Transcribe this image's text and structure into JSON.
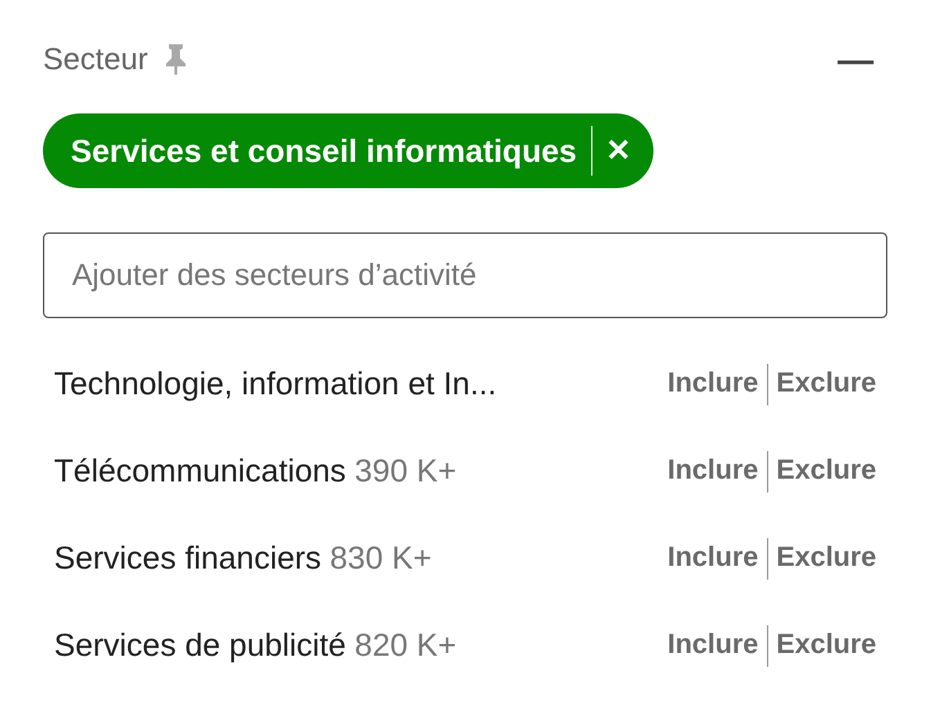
{
  "section": {
    "title": "Secteur",
    "collapse": "—"
  },
  "chip": {
    "label": "Services et conseil informatiques",
    "remove": "✕"
  },
  "search": {
    "placeholder": "Ajouter des secteurs d’activité"
  },
  "industries": [
    {
      "name": "Technologie, information et In...",
      "include": "Inclure",
      "exclude": "Exclure"
    },
    {
      "name": "Télécommunications",
      "count": "390 K+",
      "include": "Inclure",
      "exclude": "Exclure"
    },
    {
      "name": "Services financiers",
      "count": "830 K+",
      "include": "Inclure",
      "exclude": "Exclure"
    },
    {
      "name": "Services de publicité",
      "count": "820 K+",
      "include": "Inclure",
      "exclude": "Exclure"
    }
  ]
}
